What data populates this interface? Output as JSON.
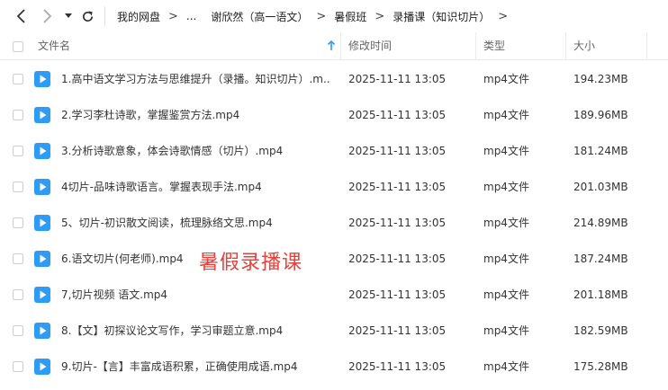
{
  "toolbar": {
    "breadcrumbs": [
      "我的网盘",
      "...",
      "谢欣然（高一语文）",
      "暑假班",
      "录播课（知识切片）"
    ]
  },
  "columns": {
    "name": "文件名",
    "modified": "修改时间",
    "type": "类型",
    "size": "大小"
  },
  "files": [
    {
      "name": "1.高中语文学习方法与思维提升（录播。知识切片）.m...",
      "modified": "2025-11-11 13:05",
      "type": "mp4文件",
      "size": "194.23MB"
    },
    {
      "name": "2.学习李杜诗歌，掌握鉴赏方法.mp4",
      "modified": "2025-11-11 13:05",
      "type": "mp4文件",
      "size": "189.96MB"
    },
    {
      "name": "3.分析诗歌意象，体会诗歌情感（切片）.mp4",
      "modified": "2025-11-11 13:05",
      "type": "mp4文件",
      "size": "181.24MB"
    },
    {
      "name": "4切片-品味诗歌语言。掌握表现手法.mp4",
      "modified": "2025-11-11 13:05",
      "type": "mp4文件",
      "size": "201.03MB"
    },
    {
      "name": "5、切片-初识散文阅读，梳理脉络文思.mp4",
      "modified": "2025-11-11 13:05",
      "type": "mp4文件",
      "size": "214.89MB"
    },
    {
      "name": "6.语文切片(何老师).mp4",
      "modified": "2025-11-11 13:05",
      "type": "mp4文件",
      "size": "187.24MB"
    },
    {
      "name": "7,切片视频 语文.mp4",
      "modified": "2025-11-11 13:05",
      "type": "mp4文件",
      "size": "201.18MB"
    },
    {
      "name": "8.【文】初探议论文写作，学习审题立意.mp4",
      "modified": "2025-11-11 13:05",
      "type": "mp4文件",
      "size": "182.59MB"
    },
    {
      "name": "9.切片-【言】丰富成语积累，正确使用成语.mp4",
      "modified": "2025-11-11 13:05",
      "type": "mp4文件",
      "size": "175.28MB"
    }
  ],
  "watermark": "暑假录播课",
  "colors": {
    "accent": "#2e9bf5",
    "watermark": "#e8413a"
  }
}
